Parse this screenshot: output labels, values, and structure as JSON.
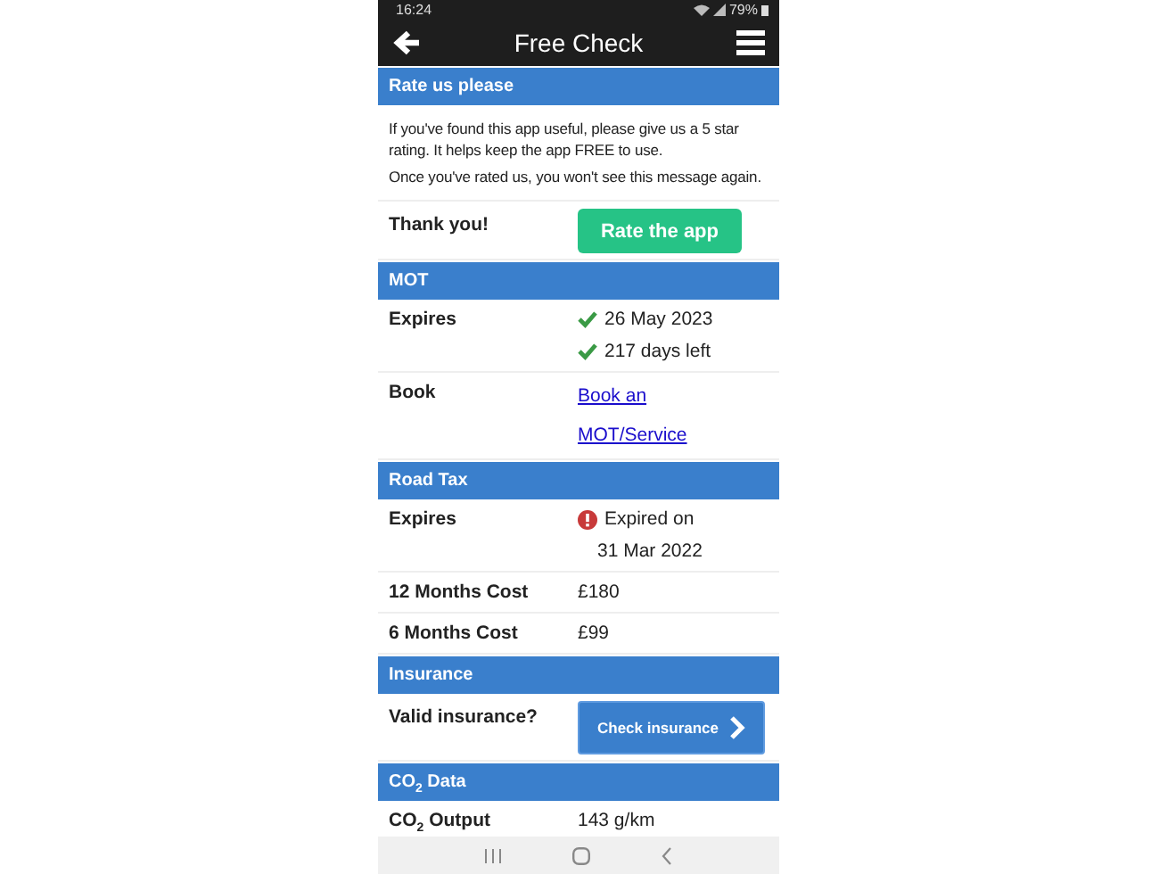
{
  "status_bar": {
    "time": "16:24",
    "battery": "79%"
  },
  "header": {
    "title": "Free Check"
  },
  "sections": [
    {
      "title": "Rate us please",
      "rows": [
        {
          "kind": "paragraphs",
          "texts": [
            "If you've found this app useful, please give us a 5 star rating. It helps keep the app FREE to use.",
            "Once you've rated us, you won't see this message again."
          ]
        },
        {
          "kind": "rate",
          "label": "Thank you!",
          "button": "Rate the app"
        }
      ]
    },
    {
      "title": "MOT",
      "rows": [
        {
          "kind": "lines",
          "label": "Expires",
          "lines": [
            {
              "kind": "valid",
              "text": "26 May 2023"
            },
            {
              "kind": "valid",
              "text": "217 days left"
            }
          ]
        },
        {
          "kind": "link",
          "label": "Book",
          "links": [
            "Book an",
            "MOT/Service"
          ]
        }
      ]
    },
    {
      "title": "Road Tax",
      "rows": [
        {
          "kind": "lines",
          "label": "Expires",
          "lines": [
            {
              "kind": "expired",
              "text": "Expired on"
            },
            {
              "kind": "plain",
              "text": "31 Mar 2022"
            }
          ]
        },
        {
          "kind": "lines",
          "label": "12 Months Cost",
          "lines": [
            {
              "kind": "plain",
              "text": "£180"
            }
          ]
        },
        {
          "kind": "lines",
          "label": "6 Months Cost",
          "lines": [
            {
              "kind": "plain",
              "text": "£99"
            }
          ]
        }
      ]
    },
    {
      "title": "Insurance",
      "rows": [
        {
          "kind": "insurance",
          "label": "Valid insurance?",
          "button": "Check insurance"
        }
      ]
    },
    {
      "title": "CO$_{2}$ Data",
      "rows": [
        {
          "kind": "lines",
          "label": "CO$_{2}$ Output",
          "lines": [
            {
              "kind": "plain",
              "text": "143 g/km"
            }
          ]
        }
      ]
    }
  ]
}
